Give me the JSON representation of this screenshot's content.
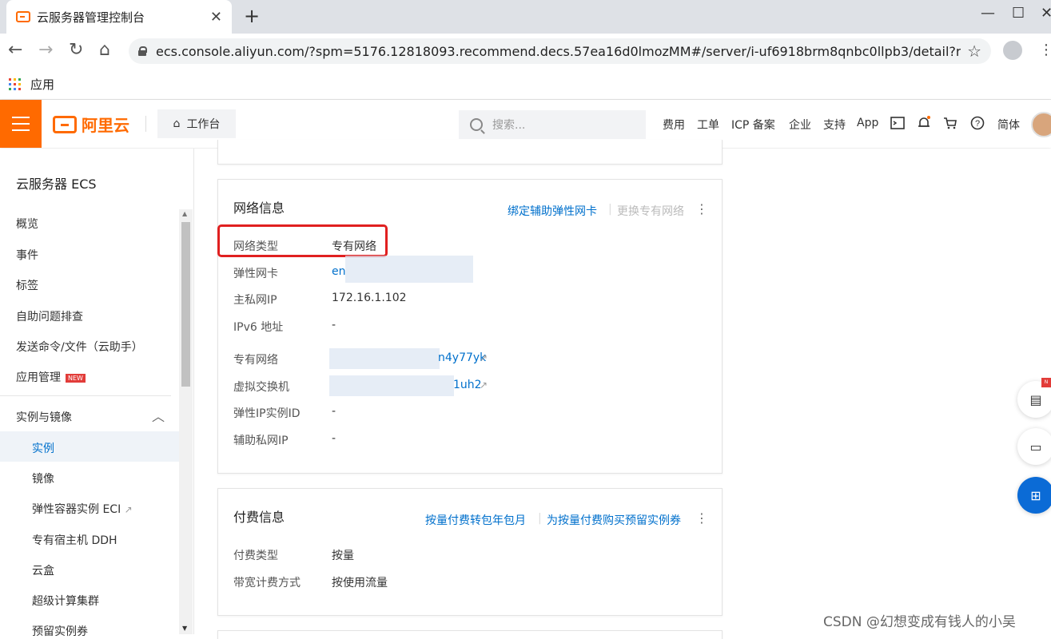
{
  "browser": {
    "tab_title": "云服务器管理控制台",
    "tab_close": "✕",
    "new_tab": "+",
    "window_controls": [
      "—",
      "☐",
      "✕"
    ],
    "url": "ecs.console.aliyun.com/?spm=5176.12818093.recommend.decs.57ea16d0lmozMM#/server/i-uf6918brm8qnbc0llpb3/detail?regi···",
    "bookmarks_label": "应用",
    "apps_colors": [
      "#ea4335",
      "#fbbc05",
      "#34a853",
      "#4285f4",
      "#ea4335",
      "#fbbc05",
      "#34a853",
      "#4285f4",
      "#ea4335"
    ]
  },
  "header": {
    "brand": "阿里云",
    "workbench": "工作台",
    "search_placeholder": "搜索...",
    "nav": [
      "费用",
      "工单",
      "ICP 备案",
      "企业",
      "支持",
      "App"
    ],
    "lang": "简体",
    "accent_color": "#ff6a00"
  },
  "sidebar": {
    "title": "云服务器 ECS",
    "items": [
      "概览",
      "事件",
      "标签",
      "自助问题排查",
      "发送命令/文件（云助手）",
      "应用管理"
    ],
    "new_badge": "NEW",
    "group": "实例与镜像",
    "sub_items": [
      "实例",
      "镜像",
      "弹性容器实例 ECI",
      "专有宿主机 DDH",
      "云盒",
      "超级计算集群",
      "预留实例券"
    ]
  },
  "network_card": {
    "title": "网络信息",
    "action_bind": "绑定辅助弹性网卡",
    "action_change": "更换专有网络",
    "rows": [
      {
        "label": "网络类型",
        "value": "专有网络"
      },
      {
        "label": "弹性网卡",
        "value": "en"
      },
      {
        "label": "主私网IP",
        "value": "172.16.1.102"
      },
      {
        "label": "IPv6 地址",
        "value": "-"
      },
      {
        "label": "专有网络",
        "value": "n4y77yk"
      },
      {
        "label": "虚拟交换机",
        "value": "1uh2"
      },
      {
        "label": "弹性IP实例ID",
        "value": "-"
      },
      {
        "label": "辅助私网IP",
        "value": "-"
      }
    ]
  },
  "billing_card": {
    "title": "付费信息",
    "action_1": "按量付费转包年包月",
    "action_2": "为按量付费购买预留实例券",
    "rows": [
      {
        "label": "付费类型",
        "value": "按量"
      },
      {
        "label": "带宽计费方式",
        "value": "按使用流量"
      }
    ]
  },
  "float_badge": "N",
  "watermark": "CSDN @幻想变成有钱人的小吴"
}
